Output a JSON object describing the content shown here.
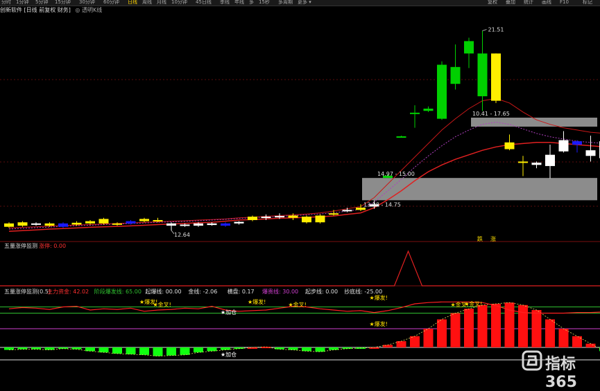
{
  "toolbar": {
    "items": [
      "分时",
      "1分钟",
      "5分钟",
      "15分钟",
      "30分钟",
      "60分钟",
      "日线",
      "周线",
      "月线",
      "10分钟",
      "45日线",
      "季线",
      "年线",
      "多",
      "15秒",
      "多周期",
      "更多 ▾"
    ],
    "active_index": 6,
    "right_items": [
      "复权",
      "叠加",
      "统计",
      "画线",
      "F10",
      "标记"
    ]
  },
  "title_bar": {
    "text": "创新软件 [日线 前复权 财务]",
    "extra": "◎ 透明K线"
  },
  "main_panel": {
    "high_label": "21.51",
    "low_label": "12.64",
    "zone_upper_label": "10.41 - 17.65",
    "zone_mid_label": "14.97 - 15.00",
    "zone_lower_label": "13.98 - 14.75",
    "signal_labels": [
      "跌",
      "涨"
    ]
  },
  "middle_panel": {
    "title": "五量涨停监测",
    "value_label": "涨停: 0.00"
  },
  "bottom_panel": {
    "title": "五量涨停监测(0.5)",
    "legend": [
      {
        "text": "主力资金: 42.02",
        "color": "#ff3030"
      },
      {
        "text": "阶段爆发线: 65.00",
        "color": "#30c030"
      },
      {
        "text": "起爆线: 00.00",
        "color": "#e0e0e0"
      },
      {
        "text": "金线: -2.06",
        "color": "#e0e0e0"
      },
      {
        "text": "横盘: 0.17",
        "color": "#e0e0e0"
      },
      {
        "text": "爆贵线: 30.00",
        "color": "#d040d0"
      },
      {
        "text": "起步线: 0.00",
        "color": "#e0e0e0"
      },
      {
        "text": "抄底线: -25.00",
        "color": "#e0e0e0"
      }
    ],
    "annotations": [
      "★爆发!",
      "★金叉!",
      "★加仓",
      "★爆发!",
      "★金叉!",
      "★爆发!",
      "★爆发!",
      "★金叉!",
      "★加仓",
      "★金叉!"
    ]
  },
  "watermark": {
    "text": "指标365"
  },
  "chart_data": {
    "type": "candlestick",
    "ylim": [
      12.3,
      22.2
    ],
    "candles": [
      {
        "o": 12.8,
        "c": 12.95,
        "h": 13.0,
        "l": 12.75,
        "color": "yellow"
      },
      {
        "o": 12.85,
        "c": 13.0,
        "h": 13.05,
        "l": 12.8,
        "color": "yellow"
      },
      {
        "o": 12.9,
        "c": 12.95,
        "h": 13.0,
        "l": 12.85,
        "color": "white"
      },
      {
        "o": 12.95,
        "c": 12.85,
        "h": 13.0,
        "l": 12.8,
        "color": "yellow"
      },
      {
        "o": 12.95,
        "c": 12.8,
        "h": 13.0,
        "l": 12.75,
        "color": "blue"
      },
      {
        "o": 12.9,
        "c": 12.98,
        "h": 13.05,
        "l": 12.85,
        "color": "yellow"
      },
      {
        "o": 12.95,
        "c": 13.05,
        "h": 13.1,
        "l": 12.9,
        "color": "yellow"
      },
      {
        "o": 13.15,
        "c": 12.95,
        "h": 13.2,
        "l": 12.9,
        "color": "yellow"
      },
      {
        "o": 12.9,
        "c": 12.95,
        "h": 13.0,
        "l": 12.85,
        "color": "yellow"
      },
      {
        "o": 12.95,
        "c": 13.05,
        "h": 13.1,
        "l": 12.9,
        "color": "blue"
      },
      {
        "o": 13.05,
        "c": 13.15,
        "h": 13.2,
        "l": 13.0,
        "color": "yellow"
      },
      {
        "o": 13.1,
        "c": 13.05,
        "h": 13.2,
        "l": 13.0,
        "color": "yellow"
      },
      {
        "o": 12.95,
        "c": 12.85,
        "h": 13.0,
        "l": 12.64,
        "color": "white"
      },
      {
        "o": 12.85,
        "c": 12.9,
        "h": 12.95,
        "l": 12.8,
        "color": "white"
      },
      {
        "o": 12.85,
        "c": 12.95,
        "h": 13.0,
        "l": 12.8,
        "color": "white"
      },
      {
        "o": 12.95,
        "c": 12.88,
        "h": 13.0,
        "l": 12.85,
        "color": "white"
      },
      {
        "o": 12.95,
        "c": 12.85,
        "h": 13.0,
        "l": 12.8,
        "color": "blue"
      },
      {
        "o": 12.95,
        "c": 13.02,
        "h": 13.05,
        "l": 12.9,
        "color": "white"
      },
      {
        "o": 13.1,
        "c": 13.25,
        "h": 13.3,
        "l": 13.05,
        "color": "yellow"
      },
      {
        "o": 13.2,
        "c": 13.25,
        "h": 13.35,
        "l": 13.1,
        "color": "white"
      },
      {
        "o": 13.25,
        "c": 13.28,
        "h": 13.4,
        "l": 13.15,
        "color": "white"
      },
      {
        "o": 13.3,
        "c": 13.2,
        "h": 13.4,
        "l": 13.1,
        "color": "yellow"
      },
      {
        "o": 13.0,
        "c": 13.25,
        "h": 13.3,
        "l": 12.95,
        "color": "yellow"
      },
      {
        "o": 13.0,
        "c": 13.3,
        "h": 13.35,
        "l": 12.95,
        "color": "yellow"
      },
      {
        "o": 13.35,
        "c": 13.4,
        "h": 13.55,
        "l": 13.3,
        "color": "yellow"
      },
      {
        "o": 13.5,
        "c": 13.55,
        "h": 13.65,
        "l": 13.45,
        "color": "white"
      },
      {
        "o": 13.55,
        "c": 13.65,
        "h": 13.8,
        "l": 13.5,
        "color": "yellow"
      },
      {
        "o": 13.7,
        "c": 13.8,
        "h": 13.98,
        "l": 13.6,
        "color": "white"
      },
      {
        "o": 14.97,
        "c": 15.07,
        "h": 15.15,
        "l": 14.97,
        "color": "green"
      },
      {
        "o": 16.8,
        "c": 16.82,
        "h": 16.85,
        "l": 16.78,
        "color": "green"
      },
      {
        "o": 17.85,
        "c": 17.87,
        "h": 18.2,
        "l": 17.2,
        "color": "green"
      },
      {
        "o": 17.95,
        "c": 18.05,
        "h": 18.15,
        "l": 17.9,
        "color": "green"
      },
      {
        "o": 17.6,
        "c": 20.0,
        "h": 20.15,
        "l": 17.55,
        "color": "green"
      },
      {
        "o": 19.15,
        "c": 19.9,
        "h": 20.9,
        "l": 18.9,
        "color": "green"
      },
      {
        "o": 20.5,
        "c": 21.05,
        "h": 21.2,
        "l": 19.85,
        "color": "green"
      },
      {
        "o": 20.5,
        "c": 18.6,
        "h": 21.51,
        "l": 17.95,
        "color": "green"
      },
      {
        "o": 20.5,
        "c": 18.4,
        "h": 20.5,
        "l": 18.3,
        "color": "yellow"
      },
      {
        "o": 16.55,
        "c": 16.25,
        "h": 16.9,
        "l": 16.2,
        "color": "yellow"
      },
      {
        "o": 15.7,
        "c": 15.7,
        "h": 15.95,
        "l": 15.05,
        "color": "yellow"
      },
      {
        "o": 15.55,
        "c": 15.65,
        "h": 15.7,
        "l": 15.4,
        "color": "white"
      },
      {
        "o": 15.5,
        "c": 16.0,
        "h": 16.45,
        "l": 14.95,
        "color": "white"
      },
      {
        "o": 16.15,
        "c": 16.65,
        "h": 17.05,
        "l": 16.1,
        "color": "white"
      },
      {
        "o": 16.45,
        "c": 16.6,
        "h": 16.65,
        "l": 16.1,
        "color": "blue"
      },
      {
        "o": 15.95,
        "c": 16.2,
        "h": 16.85,
        "l": 15.7,
        "color": "white"
      },
      {
        "o": 15.85,
        "c": 16.6,
        "h": 16.8,
        "l": 15.7,
        "color": "white"
      },
      {
        "o": 16.0,
        "c": 16.3,
        "h": 16.75,
        "l": 15.95,
        "color": "white"
      }
    ],
    "ma_red": [
      12.6,
      12.63,
      12.66,
      12.7,
      12.72,
      12.75,
      12.78,
      12.8,
      12.82,
      12.84,
      12.87,
      12.9,
      12.92,
      12.95,
      12.98,
      13.0,
      13.05,
      13.1,
      13.12,
      13.15,
      13.18,
      13.2,
      13.22,
      13.25,
      13.28,
      13.35,
      13.42,
      13.65,
      14.0,
      14.4,
      14.85,
      15.25,
      15.55,
      15.8,
      16.0,
      16.2,
      16.35,
      16.45,
      16.5,
      16.55,
      16.55,
      16.5,
      16.45,
      16.4,
      16.35,
      16.35
    ],
    "ma_red2": [
      12.75,
      12.78,
      12.8,
      12.83,
      12.86,
      12.88,
      12.9,
      12.92,
      12.95,
      12.97,
      13.0,
      13.02,
      13.05,
      13.07,
      13.1,
      13.12,
      13.15,
      13.2,
      13.23,
      13.27,
      13.3,
      13.33,
      13.37,
      13.42,
      13.5,
      13.6,
      13.7,
      14.1,
      14.7,
      15.3,
      15.9,
      16.5,
      17.1,
      17.6,
      18.05,
      18.4,
      18.5,
      18.3,
      17.9,
      17.55,
      17.35,
      17.2,
      17.1,
      17.0,
      16.95,
      16.95
    ],
    "ma_purple": [
      12.7,
      12.73,
      12.76,
      12.79,
      12.82,
      12.85,
      12.87,
      12.9,
      12.92,
      12.95,
      12.97,
      13.0,
      13.02,
      13.04,
      13.07,
      13.1,
      13.13,
      13.17,
      13.2,
      13.23,
      13.26,
      13.3,
      13.33,
      13.37,
      13.42,
      13.5,
      13.58,
      13.9,
      14.4,
      14.9,
      15.45,
      15.95,
      16.4,
      16.8,
      17.1,
      17.35,
      17.45,
      17.35,
      17.15,
      16.95,
      16.8,
      16.7,
      16.6,
      16.55,
      16.5,
      16.5
    ],
    "zones": [
      {
        "from": 17.25,
        "to": 17.65
      },
      {
        "from": 13.98,
        "to": 14.97
      }
    ],
    "mid_spike_index": 29,
    "bottom_main": [
      62,
      64,
      63,
      61,
      65,
      66,
      60,
      62,
      61,
      63,
      58,
      60,
      61,
      63,
      62,
      66,
      60,
      58,
      59,
      60,
      63,
      66,
      65,
      62,
      60,
      58,
      59,
      56,
      59,
      64,
      70,
      72,
      73,
      73,
      73,
      72,
      67,
      60,
      56,
      55,
      55,
      55,
      56,
      56,
      57,
      58
    ],
    "bottom_bars": [
      -4,
      -3,
      -3,
      -4,
      -2,
      -3,
      -6,
      -8,
      -10,
      -11,
      -12,
      -14,
      -13,
      -12,
      -8,
      -6,
      -4,
      -2,
      0,
      1,
      -3,
      -4,
      -6,
      -7,
      -4,
      -2,
      -1,
      0,
      4,
      10,
      18,
      30,
      45,
      55,
      62,
      68,
      70,
      72,
      68,
      60,
      45,
      30,
      18,
      6,
      -6,
      -10
    ]
  }
}
